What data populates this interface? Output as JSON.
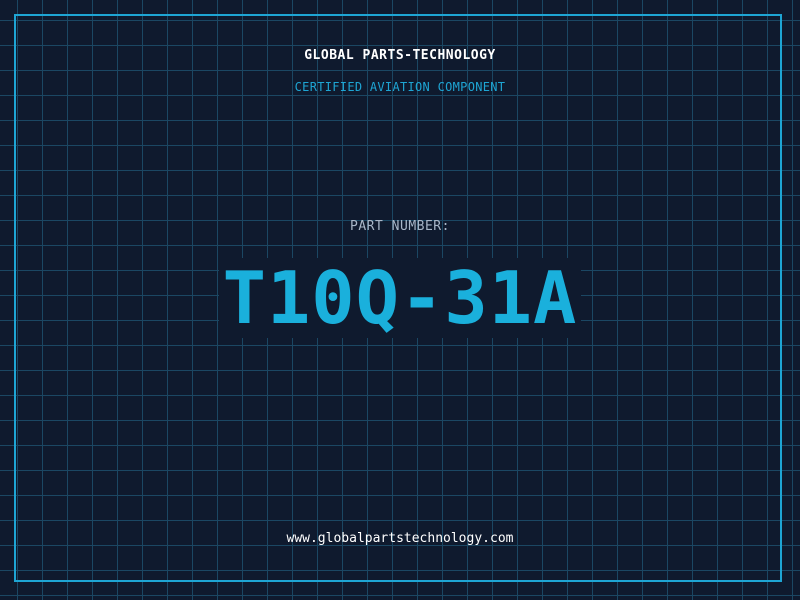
{
  "header": {
    "company_name": "GLOBAL PARTS-TECHNOLOGY",
    "tagline": "CERTIFIED AVIATION COMPONENT"
  },
  "part": {
    "label": "PART NUMBER:",
    "number": "T10Q-31A"
  },
  "footer": {
    "website": "www.globalpartstechnology.com"
  },
  "colors": {
    "background": "#0f1a2e",
    "grid": "#1c4a66",
    "accent": "#1ea5d4",
    "part_number": "#1ab0dc",
    "label": "#a9b7c9",
    "text": "#ffffff"
  }
}
